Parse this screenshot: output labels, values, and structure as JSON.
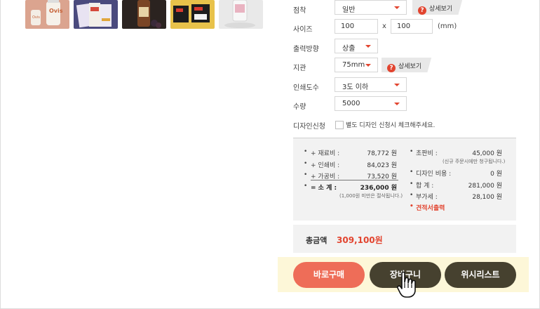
{
  "thumbnails": [
    {
      "name": "thumb-1",
      "label": "Ovis"
    },
    {
      "name": "thumb-2",
      "label": ""
    },
    {
      "name": "thumb-3",
      "label": ""
    },
    {
      "name": "thumb-4",
      "label": ""
    },
    {
      "name": "thumb-5",
      "label": ""
    }
  ],
  "form": {
    "coating": {
      "label": "점착",
      "value": "일반",
      "detail": "상세보기"
    },
    "size": {
      "label": "사이즈",
      "width": "100",
      "x": "x",
      "height": "100",
      "unit": "(mm)"
    },
    "direction": {
      "label": "출력방향",
      "value": "상출"
    },
    "core": {
      "label": "지관",
      "value": "75mm",
      "detail": "상세보기"
    },
    "colors": {
      "label": "인쇄도수",
      "value": "3도 이하"
    },
    "quantity": {
      "label": "수량",
      "value": "5000"
    },
    "design": {
      "label": "디자인신청",
      "text": "별도 디자인 신청시 체크해주세요."
    }
  },
  "price": {
    "material": {
      "label": "+ 재료비 :",
      "value": "78,772 원"
    },
    "print": {
      "label": "+ 인쇄비 :",
      "value": "84,023 원"
    },
    "process": {
      "label": "+ 가공비 :",
      "value": "73,520 원"
    },
    "subtotal": {
      "label": "= 소    계 :",
      "value": "236,000 원",
      "note": "(1,000원 미만은 절삭됩니다.)"
    },
    "plate": {
      "label": "초판비 :",
      "value": "45,000 원",
      "note": "(신규 주문시에만 청구됩니다.)"
    },
    "design_fee": {
      "label": "디자인 비용 :",
      "value": "0 원"
    },
    "sum": {
      "label": "합    계 :",
      "value": "281,000 원"
    },
    "vat": {
      "label": "부가세 :",
      "value": "28,100 원"
    },
    "quote": "견적서출력"
  },
  "total": {
    "label": "총금액",
    "value": "309,100원"
  },
  "buttons": {
    "buy": "바로구매",
    "cart": "장바구니",
    "wish": "위시리스트"
  },
  "colors": {
    "accent": "#e2442f",
    "buy": "#ee6d58",
    "dark": "#46412f",
    "bar": "#fdf7d8"
  }
}
